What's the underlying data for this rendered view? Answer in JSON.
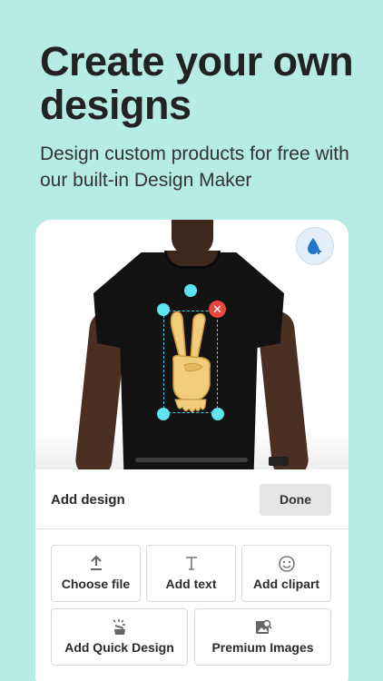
{
  "promo": {
    "headline": "Create your own designs",
    "subheadline": "Design custom products for free with our built-in Design Maker"
  },
  "editor": {
    "colors": {
      "background": "#b6ece3",
      "selection_handle": "#5ee3f0",
      "delete_button": "#e8473f",
      "shirt": "#121212"
    },
    "color_picker_icon": "droplet-plus-icon",
    "design_icon": "peace-hand-icon",
    "delete_icon": "close-icon"
  },
  "panel": {
    "title": "Add design",
    "done_label": "Done",
    "tools": [
      {
        "label": "Choose file",
        "icon": "upload-icon"
      },
      {
        "label": "Add text",
        "icon": "text-icon"
      },
      {
        "label": "Add clipart",
        "icon": "smiley-icon"
      },
      {
        "label": "Add Quick Design",
        "icon": "magic-wand-icon"
      },
      {
        "label": "Premium Images",
        "icon": "image-search-icon"
      }
    ]
  }
}
